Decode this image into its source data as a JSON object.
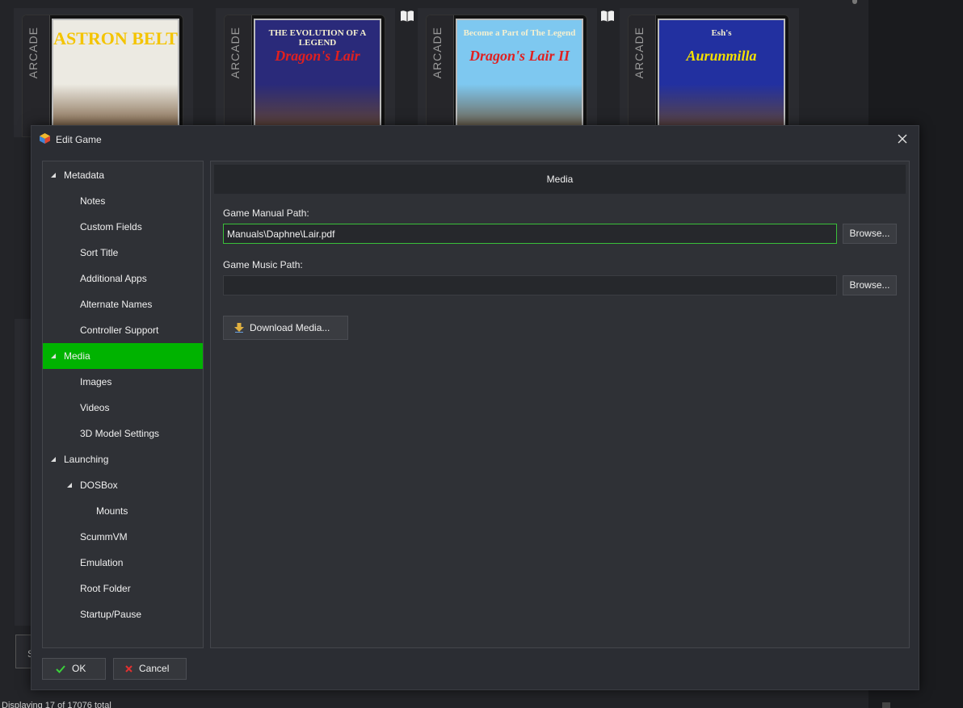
{
  "background": {
    "spine_label": "ARCADE",
    "tiles": [
      {
        "title_line1": "ASTRON BELT",
        "title_line2": "",
        "color_top": "#eceae2",
        "color_title": "#f4c400"
      },
      {
        "title_line1": "THE EVOLUTION OF A LEGEND",
        "title_line2": "Dragon's Lair",
        "color_top": "#2a2a7a",
        "color_title": "#e02020"
      },
      {
        "title_line1": "Become a Part of The Legend",
        "title_line2": "Dragon's Lair II",
        "color_top": "#7ec8f0",
        "color_title": "#e02020"
      },
      {
        "title_line1": "Esh's",
        "title_line2": "Aurunmilla",
        "color_top": "#2230a0",
        "color_title": "#f4e000"
      }
    ],
    "status_text": "Displaying 17 of 17076 total",
    "small_button": "S"
  },
  "dialog": {
    "title": "Edit Game",
    "nav": [
      {
        "label": "Metadata",
        "level": 0,
        "expanded": true,
        "active": false
      },
      {
        "label": "Notes",
        "level": 1,
        "expanded": false,
        "active": false
      },
      {
        "label": "Custom Fields",
        "level": 1,
        "expanded": false,
        "active": false
      },
      {
        "label": "Sort Title",
        "level": 1,
        "expanded": false,
        "active": false
      },
      {
        "label": "Additional Apps",
        "level": 1,
        "expanded": false,
        "active": false
      },
      {
        "label": "Alternate Names",
        "level": 1,
        "expanded": false,
        "active": false
      },
      {
        "label": "Controller Support",
        "level": 1,
        "expanded": false,
        "active": false
      },
      {
        "label": "Media",
        "level": 0,
        "expanded": true,
        "active": true
      },
      {
        "label": "Images",
        "level": 1,
        "expanded": false,
        "active": false
      },
      {
        "label": "Videos",
        "level": 1,
        "expanded": false,
        "active": false
      },
      {
        "label": "3D Model Settings",
        "level": 1,
        "expanded": false,
        "active": false
      },
      {
        "label": "Launching",
        "level": 0,
        "expanded": true,
        "active": false
      },
      {
        "label": "DOSBox",
        "level": 1,
        "expanded": true,
        "active": false
      },
      {
        "label": "Mounts",
        "level": 2,
        "expanded": false,
        "active": false
      },
      {
        "label": "ScummVM",
        "level": 1,
        "expanded": false,
        "active": false
      },
      {
        "label": "Emulation",
        "level": 1,
        "expanded": false,
        "active": false
      },
      {
        "label": "Root Folder",
        "level": 1,
        "expanded": false,
        "active": false
      },
      {
        "label": "Startup/Pause",
        "level": 1,
        "expanded": false,
        "active": false
      }
    ],
    "content": {
      "header": "Media",
      "manual_label": "Game Manual Path:",
      "manual_value": "Manuals\\Daphne\\Lair.pdf",
      "music_label": "Game Music Path:",
      "music_value": "",
      "browse_label": "Browse...",
      "download_label": "Download Media..."
    },
    "footer": {
      "ok_label": "OK",
      "cancel_label": "Cancel"
    },
    "colors": {
      "accent": "#00b300",
      "focus_border": "#3ac03a",
      "cancel_x": "#e03030"
    }
  }
}
